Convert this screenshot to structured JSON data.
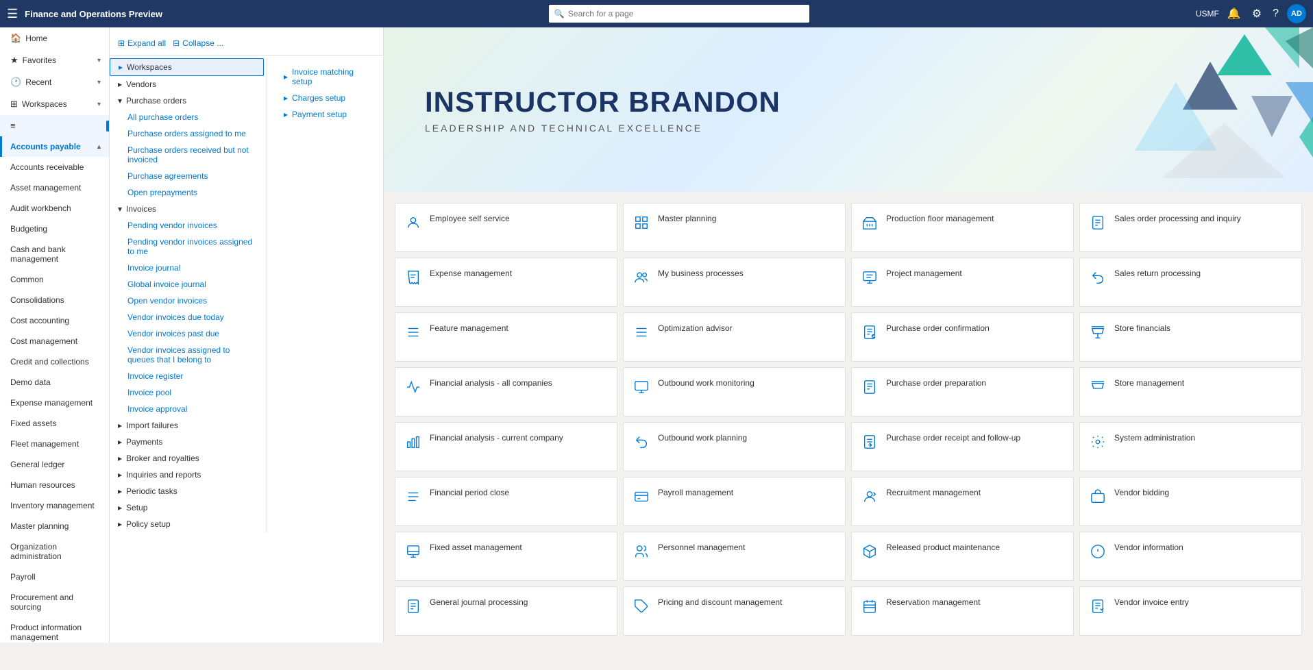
{
  "topbar": {
    "title": "Finance and Operations Preview",
    "search_placeholder": "Search for a page",
    "user": "USMF",
    "avatar": "AD"
  },
  "nav": {
    "items": [
      {
        "id": "home",
        "label": "Home",
        "icon": "🏠",
        "active": false
      },
      {
        "id": "favorites",
        "label": "Favorites",
        "icon": "★",
        "active": false,
        "has_chevron": true
      },
      {
        "id": "recent",
        "label": "Recent",
        "icon": "🕐",
        "active": false,
        "has_chevron": true
      },
      {
        "id": "workspaces",
        "label": "Workspaces",
        "icon": "⊞",
        "active": false,
        "has_chevron": true
      },
      {
        "id": "accounts-payable-tooltip",
        "label": "Accounts payable",
        "icon": "≡",
        "active": false
      },
      {
        "id": "accounts-payable",
        "label": "Accounts payable",
        "icon": "",
        "active": true
      },
      {
        "id": "accounts-receivable",
        "label": "Accounts receivable",
        "icon": "",
        "active": false
      },
      {
        "id": "asset-management",
        "label": "Asset management",
        "icon": "",
        "active": false
      },
      {
        "id": "audit-workbench",
        "label": "Audit workbench",
        "icon": "",
        "active": false
      },
      {
        "id": "budgeting",
        "label": "Budgeting",
        "icon": "",
        "active": false
      },
      {
        "id": "cash-bank",
        "label": "Cash and bank management",
        "icon": "",
        "active": false
      },
      {
        "id": "common",
        "label": "Common",
        "icon": "",
        "active": false
      },
      {
        "id": "consolidations",
        "label": "Consolidations",
        "icon": "",
        "active": false
      },
      {
        "id": "cost-accounting",
        "label": "Cost accounting",
        "icon": "",
        "active": false
      },
      {
        "id": "cost-management",
        "label": "Cost management",
        "icon": "",
        "active": false
      },
      {
        "id": "credit-collections",
        "label": "Credit and collections",
        "icon": "",
        "active": false
      },
      {
        "id": "demo-data",
        "label": "Demo data",
        "icon": "",
        "active": false
      },
      {
        "id": "expense-management",
        "label": "Expense management",
        "icon": "",
        "active": false
      },
      {
        "id": "fixed-assets",
        "label": "Fixed assets",
        "icon": "",
        "active": false
      },
      {
        "id": "fleet-management",
        "label": "Fleet management",
        "icon": "",
        "active": false
      },
      {
        "id": "general-ledger",
        "label": "General ledger",
        "icon": "",
        "active": false
      },
      {
        "id": "human-resources",
        "label": "Human resources",
        "icon": "",
        "active": false
      },
      {
        "id": "inventory-management",
        "label": "Inventory management",
        "icon": "",
        "active": false
      },
      {
        "id": "master-planning",
        "label": "Master planning",
        "icon": "",
        "active": false
      },
      {
        "id": "org-admin",
        "label": "Organization administration",
        "icon": "",
        "active": false
      },
      {
        "id": "payroll",
        "label": "Payroll",
        "icon": "",
        "active": false
      },
      {
        "id": "procurement",
        "label": "Procurement and sourcing",
        "icon": "",
        "active": false
      },
      {
        "id": "product-info",
        "label": "Product information management",
        "icon": "",
        "active": false
      }
    ]
  },
  "panel": {
    "expand_all": "Expand all",
    "collapse": "Collapse ...",
    "groups": [
      {
        "id": "workspaces",
        "label": "Workspaces",
        "expanded": true,
        "selected": true,
        "items": []
      },
      {
        "id": "vendors",
        "label": "Vendors",
        "expanded": false,
        "items": []
      },
      {
        "id": "purchase-orders",
        "label": "Purchase orders",
        "expanded": true,
        "items": [
          "All purchase orders",
          "Purchase orders assigned to me",
          "Purchase orders received but not invoiced",
          "Purchase agreements",
          "Open prepayments"
        ]
      },
      {
        "id": "invoices",
        "label": "Invoices",
        "expanded": true,
        "items": [
          "Pending vendor invoices",
          "Pending vendor invoices assigned to me",
          "Invoice journal",
          "Global invoice journal",
          "Open vendor invoices",
          "Vendor invoices due today",
          "Vendor invoices past due",
          "Vendor invoices assigned to queues that I belong to",
          "Invoice register",
          "Invoice pool",
          "Invoice approval"
        ]
      },
      {
        "id": "import-failures",
        "label": "Import failures",
        "expanded": false
      },
      {
        "id": "payments",
        "label": "Payments",
        "expanded": false,
        "items": []
      },
      {
        "id": "broker-royalties",
        "label": "Broker and royalties",
        "expanded": false,
        "items": []
      },
      {
        "id": "inquiries-reports",
        "label": "Inquiries and reports",
        "expanded": false,
        "items": []
      },
      {
        "id": "periodic-tasks",
        "label": "Periodic tasks",
        "expanded": false,
        "items": []
      },
      {
        "id": "setup",
        "label": "Setup",
        "expanded": false,
        "items": []
      },
      {
        "id": "policy-setup",
        "label": "Policy setup",
        "expanded": false,
        "items": []
      }
    ],
    "right_items": [
      "Invoice matching setup",
      "Charges setup",
      "Payment setup"
    ]
  },
  "hero": {
    "name": "INSTRUCTOR BRANDON",
    "subtitle": "LEADERSHIP AND TECHNICAL EXCELLENCE"
  },
  "workspaces": [
    {
      "id": "employee-self-service",
      "label": "Employee self service",
      "icon": "person"
    },
    {
      "id": "master-planning",
      "label": "Master planning",
      "icon": "grid"
    },
    {
      "id": "production-floor-management",
      "label": "Production floor management",
      "icon": "factory"
    },
    {
      "id": "sales-order-processing",
      "label": "Sales order processing and inquiry",
      "icon": "doc"
    },
    {
      "id": "expense-management",
      "label": "Expense management",
      "icon": "receipt"
    },
    {
      "id": "my-business-processes",
      "label": "My business processes",
      "icon": "people"
    },
    {
      "id": "project-management",
      "label": "Project management",
      "icon": "proj"
    },
    {
      "id": "sales-return-processing",
      "label": "Sales return processing",
      "icon": "return"
    },
    {
      "id": "feature-management",
      "label": "Feature management",
      "icon": "list"
    },
    {
      "id": "optimization-advisor",
      "label": "Optimization advisor",
      "icon": "list2"
    },
    {
      "id": "purchase-order-confirmation",
      "label": "Purchase order confirmation",
      "icon": "podoc"
    },
    {
      "id": "store-financials",
      "label": "Store financials",
      "icon": "store"
    },
    {
      "id": "financial-analysis-companies",
      "label": "Financial analysis - all companies",
      "icon": "chart"
    },
    {
      "id": "outbound-work-monitoring",
      "label": "Outbound work monitoring",
      "icon": "monitor"
    },
    {
      "id": "purchase-order-preparation",
      "label": "Purchase order preparation",
      "icon": "podoc2"
    },
    {
      "id": "store-management",
      "label": "Store management",
      "icon": "store2"
    },
    {
      "id": "financial-analysis-current",
      "label": "Financial analysis - current company",
      "icon": "chart2"
    },
    {
      "id": "outbound-work-planning",
      "label": "Outbound work planning",
      "icon": "outbound"
    },
    {
      "id": "purchase-order-receipt",
      "label": "Purchase order receipt and follow-up",
      "icon": "receipt2"
    },
    {
      "id": "system-administration",
      "label": "System administration",
      "icon": "gear"
    },
    {
      "id": "financial-period-close",
      "label": "Financial period close",
      "icon": "list3"
    },
    {
      "id": "payroll-management",
      "label": "Payroll management",
      "icon": "payroll"
    },
    {
      "id": "recruitment-management",
      "label": "Recruitment management",
      "icon": "recruit"
    },
    {
      "id": "vendor-bidding",
      "label": "Vendor bidding",
      "icon": "vendor"
    },
    {
      "id": "fixed-asset-management",
      "label": "Fixed asset management",
      "icon": "asset"
    },
    {
      "id": "personnel-management",
      "label": "Personnel management",
      "icon": "personnel"
    },
    {
      "id": "released-product-maintenance",
      "label": "Released product maintenance",
      "icon": "product"
    },
    {
      "id": "vendor-information",
      "label": "Vendor information",
      "icon": "vinfo"
    },
    {
      "id": "general-journal-processing",
      "label": "General journal processing",
      "icon": "journal"
    },
    {
      "id": "pricing-discount-management",
      "label": "Pricing and discount management",
      "icon": "pricing"
    },
    {
      "id": "reservation-management",
      "label": "Reservation management",
      "icon": "reserve"
    },
    {
      "id": "vendor-invoice-entry",
      "label": "Vendor invoice entry",
      "icon": "vinvoice"
    }
  ]
}
